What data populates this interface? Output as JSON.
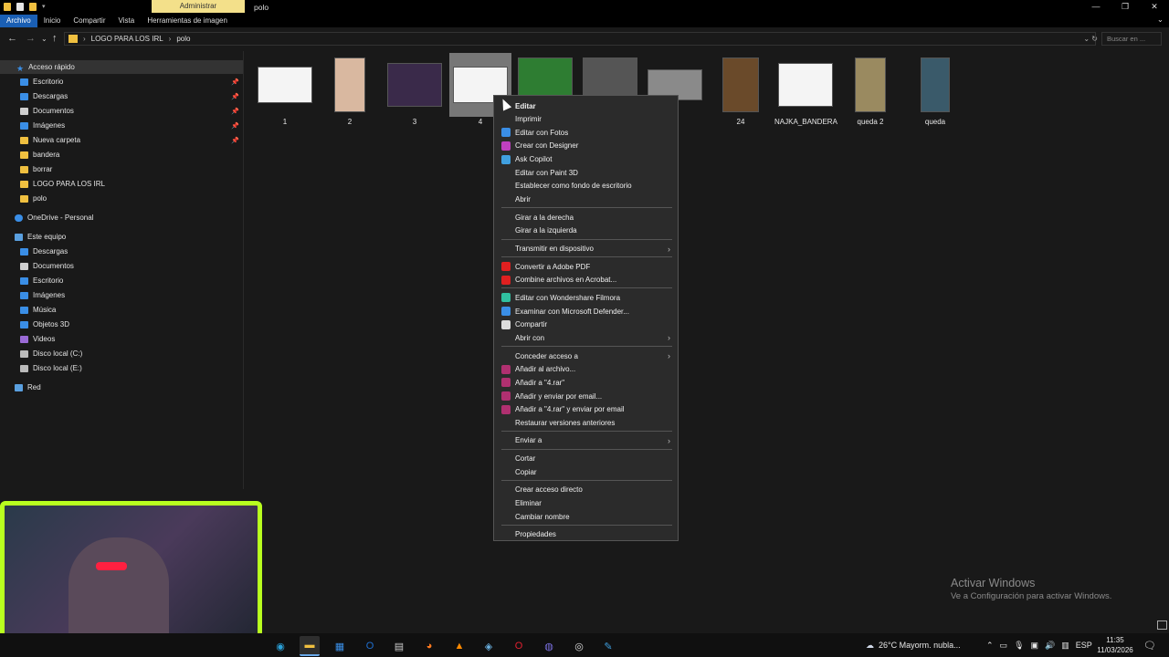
{
  "window": {
    "title": "polo",
    "contextual_tab_header": "Administrar",
    "controls": [
      "—",
      "❐",
      "✕"
    ]
  },
  "ribbon": {
    "tabs": [
      {
        "label": "Archivo",
        "active": true
      },
      {
        "label": "Inicio"
      },
      {
        "label": "Compartir"
      },
      {
        "label": "Vista"
      },
      {
        "label": "Herramientas de imagen",
        "contextual": true
      }
    ]
  },
  "address": {
    "path": [
      "LOGO PARA LOS IRL",
      "polo"
    ],
    "search_placeholder": "Buscar en ..."
  },
  "navpane": {
    "quick_access": "Acceso rápido",
    "items": [
      {
        "label": "Escritorio",
        "icon": "desktop-icon",
        "color": "#3a8ee6",
        "pinned": true
      },
      {
        "label": "Descargas",
        "icon": "download-icon",
        "color": "#3a8ee6",
        "pinned": true
      },
      {
        "label": "Documentos",
        "icon": "documents-icon",
        "color": "#cfcfcf",
        "pinned": true
      },
      {
        "label": "Imágenes",
        "icon": "pictures-icon",
        "color": "#3a8ee6",
        "pinned": true
      },
      {
        "label": "Nueva carpeta",
        "icon": "folder-icon",
        "color": "#f0c040",
        "pinned": true
      },
      {
        "label": "bandera",
        "icon": "folder-icon",
        "color": "#f0c040"
      },
      {
        "label": "borrar",
        "icon": "folder-icon",
        "color": "#f0c040"
      },
      {
        "label": "LOGO PARA LOS IRL",
        "icon": "folder-icon",
        "color": "#f0c040"
      },
      {
        "label": "polo",
        "icon": "folder-icon",
        "color": "#f0c040"
      }
    ],
    "onedrive": "OneDrive - Personal",
    "this_pc": "Este equipo",
    "pc_items": [
      {
        "label": "Descargas",
        "icon": "download-icon",
        "color": "#3a8ee6"
      },
      {
        "label": "Documentos",
        "icon": "documents-icon",
        "color": "#cfcfcf"
      },
      {
        "label": "Escritorio",
        "icon": "desktop-icon",
        "color": "#3a8ee6"
      },
      {
        "label": "Imágenes",
        "icon": "pictures-icon",
        "color": "#3a8ee6"
      },
      {
        "label": "Música",
        "icon": "music-icon",
        "color": "#3a8ee6"
      },
      {
        "label": "Objetos 3D",
        "icon": "objects-3d-icon",
        "color": "#3a8ee6"
      },
      {
        "label": "Videos",
        "icon": "videos-icon",
        "color": "#9a6ad6"
      },
      {
        "label": "Disco local (C:)",
        "icon": "drive-icon",
        "color": "#bbbbbb"
      },
      {
        "label": "Disco local (E:)",
        "icon": "drive-icon",
        "color": "#bbbbbb"
      }
    ],
    "network": "Red"
  },
  "files": [
    {
      "name": "1",
      "thumb_color": "#f4f4f4"
    },
    {
      "name": "2",
      "thumb_color": "#d9b8a0"
    },
    {
      "name": "3",
      "thumb_color": "#3a2a4a"
    },
    {
      "name": "4",
      "thumb_color": "#f4f4f4",
      "selected": true
    },
    {
      "name": "",
      "thumb_color": "#2e7d32"
    },
    {
      "name": "",
      "thumb_color": "#555555"
    },
    {
      "name": "",
      "thumb_color": "#8a8a8a"
    },
    {
      "name": "24",
      "thumb_color": "#6a4a2a"
    },
    {
      "name": "NAJKA_BANDERA",
      "thumb_color": "#f4f4f4"
    },
    {
      "name": "queda 2",
      "thumb_color": "#9a8a60"
    },
    {
      "name": "queda",
      "thumb_color": "#3a5a6a"
    }
  ],
  "context_menu": {
    "sections": [
      [
        {
          "label": "Editar",
          "bold": true
        },
        {
          "label": "Imprimir"
        },
        {
          "label": "Editar con Fotos",
          "icon": "photos-icon",
          "icolor": "#3a8ee6"
        },
        {
          "label": "Crear con Designer",
          "icon": "designer-icon",
          "icolor": "#c040c0"
        },
        {
          "label": "Ask Copilot",
          "icon": "copilot-icon",
          "icolor": "#40a0e0"
        },
        {
          "label": "Editar con Paint 3D"
        },
        {
          "label": "Establecer como fondo de escritorio"
        },
        {
          "label": "Abrir"
        }
      ],
      [
        {
          "label": "Girar a la derecha"
        },
        {
          "label": "Girar a la izquierda"
        }
      ],
      [
        {
          "label": "Transmitir en dispositivo",
          "submenu": true
        }
      ],
      [
        {
          "label": "Convertir a Adobe PDF",
          "icon": "adobe-pdf-icon",
          "icolor": "#e02020"
        },
        {
          "label": "Combine archivos en Acrobat...",
          "icon": "acrobat-icon",
          "icolor": "#e02020"
        }
      ],
      [
        {
          "label": "Editar con Wondershare Filmora",
          "icon": "filmora-icon",
          "icolor": "#30c0a0"
        },
        {
          "label": "Examinar con Microsoft Defender...",
          "icon": "defender-icon",
          "icolor": "#3a8ee6"
        },
        {
          "label": "Compartir",
          "icon": "share-icon",
          "icolor": "#dddddd"
        },
        {
          "label": "Abrir con",
          "submenu": true
        }
      ],
      [
        {
          "label": "Conceder acceso a",
          "submenu": true
        },
        {
          "label": "Añadir al archivo...",
          "icon": "winrar-icon",
          "icolor": "#b03070"
        },
        {
          "label": "Añadir a \"4.rar\"",
          "icon": "winrar-icon",
          "icolor": "#b03070"
        },
        {
          "label": "Añadir y enviar por email...",
          "icon": "winrar-icon",
          "icolor": "#b03070"
        },
        {
          "label": "Añadir a \"4.rar\" y enviar por email",
          "icon": "winrar-icon",
          "icolor": "#b03070"
        },
        {
          "label": "Restaurar versiones anteriores"
        }
      ],
      [
        {
          "label": "Enviar a",
          "submenu": true
        }
      ],
      [
        {
          "label": "Cortar"
        },
        {
          "label": "Copiar"
        }
      ],
      [
        {
          "label": "Crear acceso directo"
        },
        {
          "label": "Eliminar"
        },
        {
          "label": "Cambiar nombre"
        }
      ],
      [
        {
          "label": "Propiedades"
        }
      ]
    ]
  },
  "watermark": {
    "title": "Activar Windows",
    "subtitle": "Ve a Configuración para activar Windows."
  },
  "taskbar": {
    "apps": [
      {
        "name": "edge-icon",
        "color": "#2aa0d8",
        "glyph": "◉"
      },
      {
        "name": "file-explorer-icon",
        "color": "#f0c040",
        "glyph": "▬",
        "active": true
      },
      {
        "name": "store-icon",
        "color": "#3a8ee6",
        "glyph": "▦"
      },
      {
        "name": "outlook-icon",
        "color": "#1f6fd0",
        "glyph": "O"
      },
      {
        "name": "app-icon",
        "color": "#cccccc",
        "glyph": "▤"
      },
      {
        "name": "firefox-icon",
        "color": "#ff7a20",
        "glyph": "◕"
      },
      {
        "name": "vlc-icon",
        "color": "#ff8a00",
        "glyph": "▲"
      },
      {
        "name": "steam-icon",
        "color": "#6ab0e0",
        "glyph": "◈"
      },
      {
        "name": "opera-icon",
        "color": "#e02030",
        "glyph": "O"
      },
      {
        "name": "discord-icon",
        "color": "#7a70e0",
        "glyph": "◍"
      },
      {
        "name": "obs-icon",
        "color": "#dddddd",
        "glyph": "◎"
      },
      {
        "name": "paint-icon",
        "color": "#40a0e0",
        "glyph": "✎"
      }
    ],
    "weather": "26°C  Mayorm. nubla...",
    "lang": "ESP",
    "time": "11:35",
    "date": "11/03/2026"
  }
}
